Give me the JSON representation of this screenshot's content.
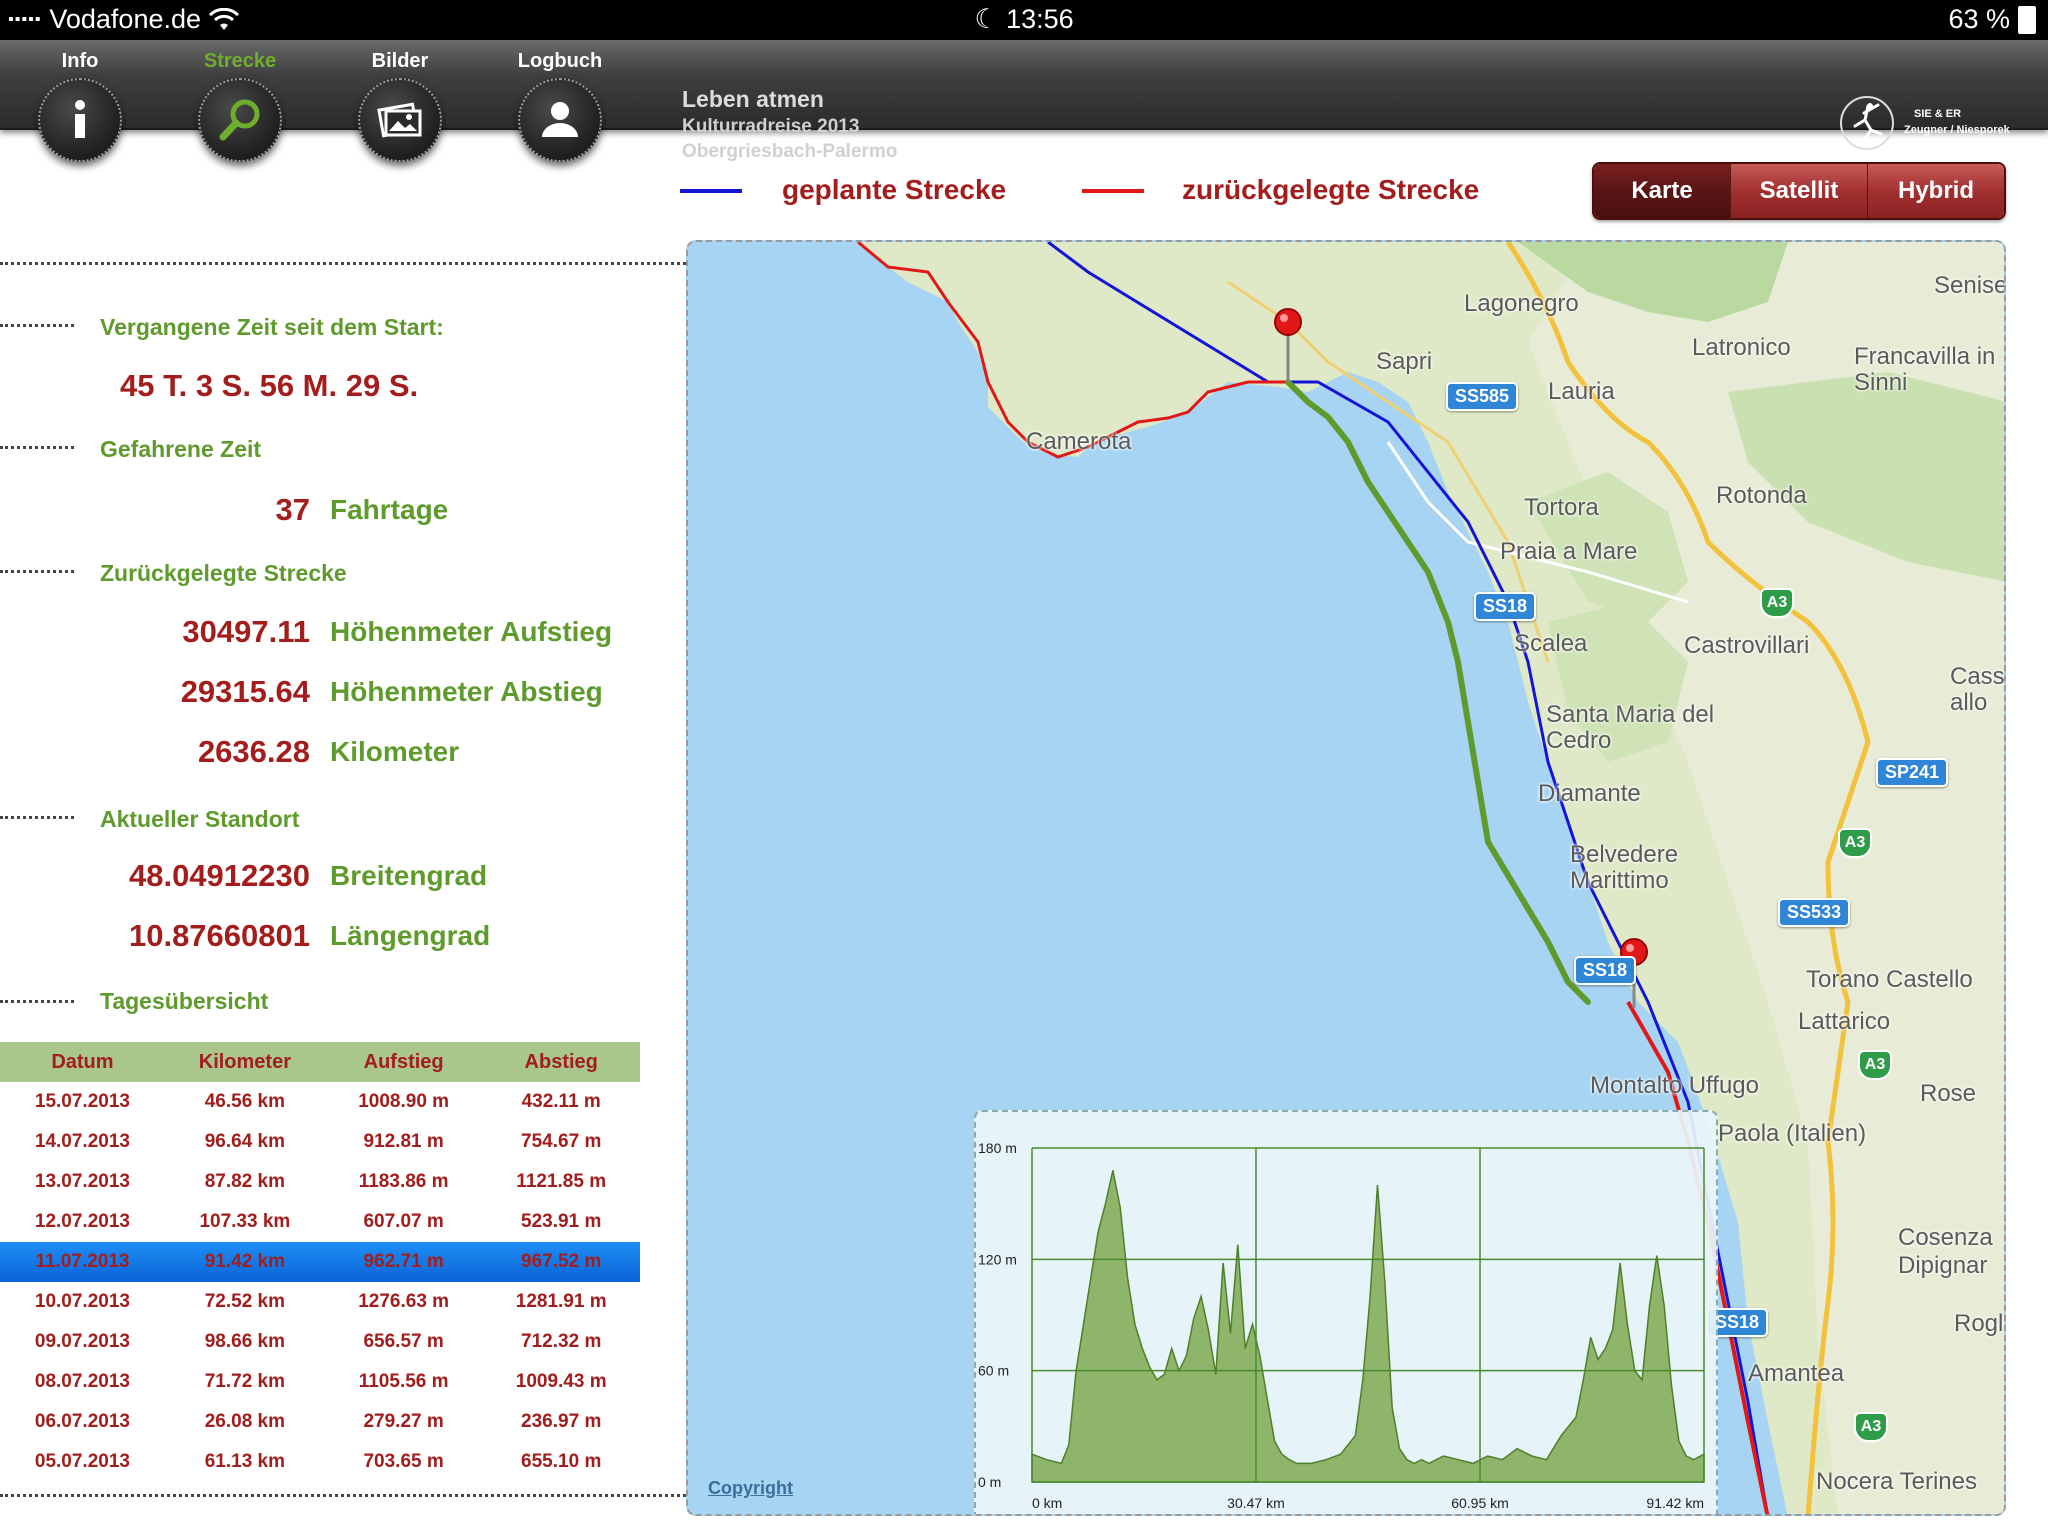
{
  "status_bar": {
    "carrier": "Vodafone.de",
    "time": "13:56",
    "battery": "63 %"
  },
  "toolbar": {
    "tabs": [
      {
        "label": "Info",
        "icon": "info-icon"
      },
      {
        "label": "Strecke",
        "icon": "search-icon"
      },
      {
        "label": "Bilder",
        "icon": "photos-icon"
      },
      {
        "label": "Logbuch",
        "icon": "user-icon"
      }
    ],
    "active_tab": "Strecke",
    "title": "Leben atmen",
    "subtitle1": "Kulturradreise 2013",
    "subtitle2": "Obergriesbach-Palermo",
    "logo_line1": "SIE & ER",
    "logo_line2": "Zeugner / Niesporek"
  },
  "legend": {
    "planned": {
      "label": "geplante Strecke",
      "color": "#1414d6"
    },
    "traveled": {
      "label": "zurückgelegte Strecke",
      "color": "#e01818"
    }
  },
  "map_type": {
    "options": [
      "Karte",
      "Satellit",
      "Hybrid"
    ],
    "selected": "Karte"
  },
  "stats": {
    "elapsed_label": "Vergangene Zeit seit dem Start:",
    "elapsed_value": "45 T. 3 S. 56 M. 29 S.",
    "driven_label": "Gefahrene Zeit",
    "driven_value": "37",
    "driven_unit": "Fahrtage",
    "distance_label": "Zurückgelegte Strecke",
    "ascent_value": "30497.11",
    "ascent_unit": "Höhenmeter Aufstieg",
    "descent_value": "29315.64",
    "descent_unit": "Höhenmeter Abstieg",
    "km_value": "2636.28",
    "km_unit": "Kilometer",
    "location_label": "Aktueller Standort",
    "lat_value": "48.04912230",
    "lat_unit": "Breitengrad",
    "lon_value": "10.87660801",
    "lon_unit": "Längengrad",
    "overview_label": "Tagesübersicht"
  },
  "table": {
    "headers": [
      "Datum",
      "Kilometer",
      "Aufstieg",
      "Abstieg"
    ],
    "selected_index": 4,
    "rows": [
      [
        "15.07.2013",
        "46.56 km",
        "1008.90 m",
        "432.11 m"
      ],
      [
        "14.07.2013",
        "96.64 km",
        "912.81 m",
        "754.67 m"
      ],
      [
        "13.07.2013",
        "87.82 km",
        "1183.86 m",
        "1121.85 m"
      ],
      [
        "12.07.2013",
        "107.33 km",
        "607.07 m",
        "523.91 m"
      ],
      [
        "11.07.2013",
        "91.42 km",
        "962.71 m",
        "967.52 m"
      ],
      [
        "10.07.2013",
        "72.52 km",
        "1276.63 m",
        "1281.91 m"
      ],
      [
        "09.07.2013",
        "98.66 km",
        "656.57 m",
        "712.32 m"
      ],
      [
        "08.07.2013",
        "71.72 km",
        "1105.56 m",
        "1009.43 m"
      ],
      [
        "06.07.2013",
        "26.08 km",
        "279.27 m",
        "236.97 m"
      ],
      [
        "05.07.2013",
        "61.13 km",
        "703.65 m",
        "655.10 m"
      ]
    ]
  },
  "map": {
    "places": [
      "Lagonegro",
      "Sapri",
      "Latronico",
      "Francavilla in Sinni",
      "Lauria",
      "Camerota",
      "Tortora",
      "Rotonda",
      "Praia a Mare",
      "Scalea",
      "Castrovillari",
      "Cass allo",
      "Santa Maria del Cedro",
      "Diamante",
      "Belvedere Marittimo",
      "Torano Castello",
      "Lattarico",
      "Montalto Uffugo",
      "Rose",
      "Paola (Italien)",
      "Cosenza",
      "Dipignar",
      "Amantea",
      "Nocera Terines",
      "Senise",
      "Rogl"
    ],
    "shields": [
      "SS585",
      "SS18",
      "SS18",
      "SS18",
      "SP241",
      "SS533"
    ],
    "motorway_shields": [
      "A3",
      "A3",
      "A3",
      "A3"
    ],
    "copyright": "Copyright"
  },
  "chart_data": {
    "type": "area",
    "title": "",
    "xlabel": "",
    "ylabel": "",
    "x_ticks": [
      "0 km",
      "30.47 km",
      "60.95 km",
      "91.42 km"
    ],
    "y_ticks": [
      "0 m",
      "60 m",
      "120 m",
      "180 m"
    ],
    "xlim": [
      0,
      91.42
    ],
    "ylim": [
      0,
      180
    ],
    "grid": true,
    "fill_color": "#8fb56a",
    "series": [
      {
        "x": [
          0,
          2,
          4,
          5,
          6,
          7,
          8,
          9,
          10,
          11,
          12,
          13,
          14,
          15,
          16,
          17,
          18,
          19,
          20,
          21,
          22,
          23,
          24,
          25,
          26,
          27,
          28,
          29,
          30,
          31,
          32,
          33,
          34,
          35,
          36,
          38,
          40,
          42,
          44,
          45,
          46,
          47,
          48,
          49,
          50,
          51,
          52,
          53,
          54,
          55,
          56,
          58,
          60,
          62,
          64,
          66,
          68,
          70,
          72,
          74,
          75,
          76,
          77,
          78,
          79,
          80,
          81,
          82,
          83,
          84,
          85,
          86,
          87,
          88,
          89,
          90,
          91.42
        ],
        "y": [
          15,
          12,
          10,
          20,
          60,
          85,
          110,
          135,
          150,
          168,
          148,
          110,
          85,
          72,
          62,
          55,
          58,
          72,
          60,
          68,
          88,
          100,
          82,
          58,
          118,
          80,
          128,
          72,
          85,
          68,
          45,
          22,
          15,
          12,
          10,
          10,
          12,
          15,
          25,
          55,
          100,
          160,
          108,
          40,
          18,
          12,
          10,
          12,
          10,
          12,
          14,
          12,
          10,
          14,
          12,
          18,
          14,
          12,
          25,
          35,
          55,
          78,
          66,
          72,
          82,
          118,
          85,
          60,
          55,
          95,
          122,
          95,
          52,
          22,
          14,
          12,
          15
        ]
      }
    ]
  }
}
